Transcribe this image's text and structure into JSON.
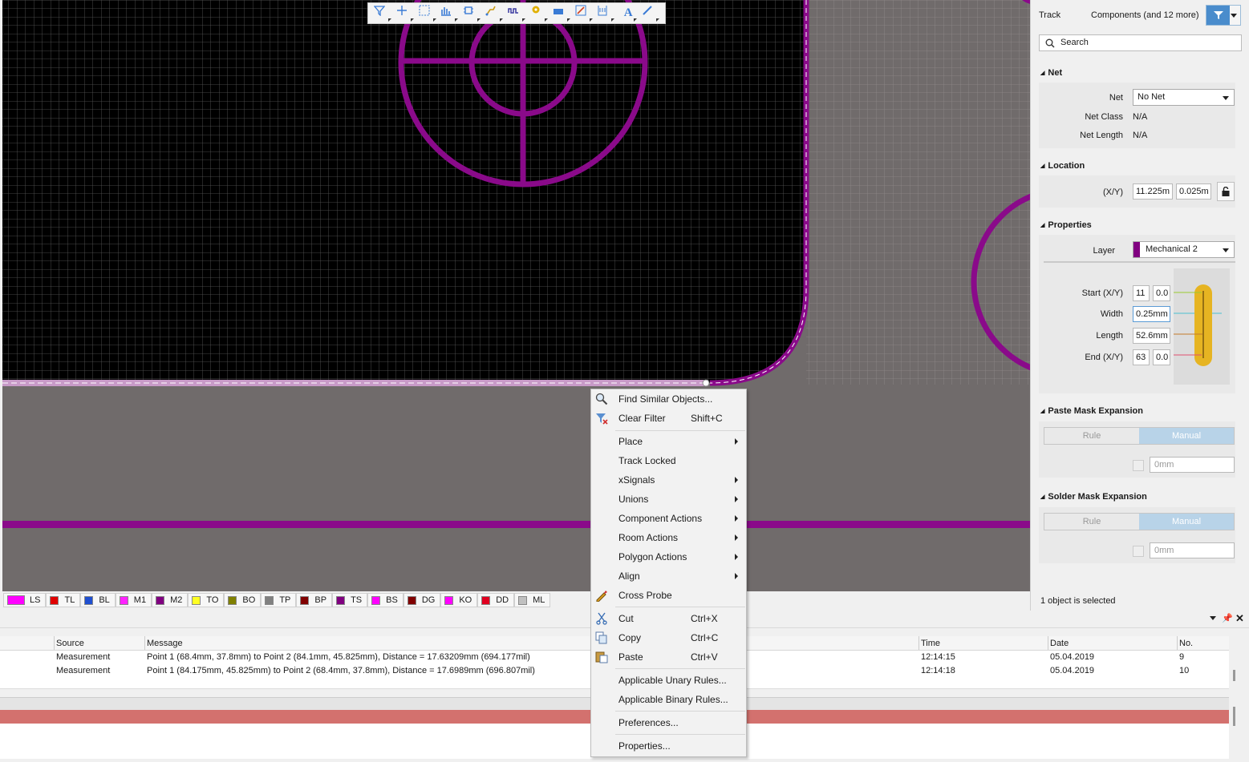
{
  "toolbar": {
    "icons": [
      "filter-icon",
      "move-icon",
      "select-rect-icon",
      "chart-icon",
      "component-icon",
      "route-icon",
      "tune-icon",
      "pad-icon",
      "fill-icon",
      "string-icon",
      "dimension-icon",
      "text-icon",
      "line-icon"
    ]
  },
  "layers": [
    {
      "label": "LS",
      "color": "#ff00ff"
    },
    {
      "label": "TL",
      "color": "#e00000"
    },
    {
      "label": "BL",
      "color": "#1f4fd0"
    },
    {
      "label": "M1",
      "color": "#ff22ff"
    },
    {
      "label": "M2",
      "color": "#800080"
    },
    {
      "label": "TO",
      "color": "#ffff22"
    },
    {
      "label": "BO",
      "color": "#808000"
    },
    {
      "label": "TP",
      "color": "#808080"
    },
    {
      "label": "BP",
      "color": "#800000"
    },
    {
      "label": "TS",
      "color": "#800080"
    },
    {
      "label": "BS",
      "color": "#ff00ff"
    },
    {
      "label": "DG",
      "color": "#800000"
    },
    {
      "label": "KO",
      "color": "#ff00ff"
    },
    {
      "label": "DD",
      "color": "#e00020"
    },
    {
      "label": "ML",
      "color": "#c0c0c0"
    }
  ],
  "panel": {
    "object_type": "Track",
    "filter_text": "Components (and 12 more)",
    "search_placeholder": "Search",
    "net": {
      "title": "Net",
      "net_label": "Net",
      "net_value": "No Net",
      "class_label": "Net Class",
      "class_value": "N/A",
      "length_label": "Net Length",
      "length_value": "N/A"
    },
    "location": {
      "title": "Location",
      "xy_label": "(X/Y)",
      "x": "11.225m",
      "y": "0.025m"
    },
    "properties": {
      "title": "Properties",
      "layer_label": "Layer",
      "layer_value": "Mechanical 2",
      "start_label": "Start (X/Y)",
      "start_x": "11",
      "start_y": "0.0",
      "width_label": "Width",
      "width_value": "0.25mm",
      "length_label": "Length",
      "length_value": "52.6mm",
      "end_label": "End (X/Y)",
      "end_x": "63",
      "end_y": "0.0"
    },
    "paste": {
      "title": "Paste Mask Expansion",
      "rule": "Rule",
      "manual": "Manual",
      "value": "0mm"
    },
    "solder": {
      "title": "Solder Mask Expansion",
      "rule": "Rule",
      "manual": "Manual",
      "value": "0mm"
    },
    "status": "1 object is selected"
  },
  "messages": {
    "headers": {
      "source": "Source",
      "message": "Message",
      "time": "Time",
      "date": "Date",
      "no": "No."
    },
    "rows": [
      {
        "source": "Measurement",
        "message": "Point 1 (68.4mm, 37.8mm) to Point 2 (84.1mm, 45.825mm), Distance = 17.63209mm (694.177mil)",
        "time": "12:14:15",
        "date": "05.04.2019",
        "no": "9"
      },
      {
        "source": "Measurement",
        "message": "Point 1 (84.175mm, 45.825mm) to Point 2 (68.4mm, 37.8mm), Distance = 17.6989mm (696.807mil)",
        "time": "12:14:18",
        "date": "05.04.2019",
        "no": "10"
      }
    ]
  },
  "context_menu": {
    "find_similar": "Find Similar Objects...",
    "clear_filter": "Clear Filter",
    "clear_filter_key": "Shift+C",
    "place": "Place",
    "track_locked": "Track Locked",
    "xsignals": "xSignals",
    "unions": "Unions",
    "component_actions": "Component Actions",
    "room_actions": "Room Actions",
    "polygon_actions": "Polygon Actions",
    "align": "Align",
    "cross_probe": "Cross Probe",
    "cut": "Cut",
    "cut_key": "Ctrl+X",
    "copy": "Copy",
    "copy_key": "Ctrl+C",
    "paste": "Paste",
    "paste_key": "Ctrl+V",
    "unary_rules": "Applicable Unary Rules...",
    "binary_rules": "Applicable Binary Rules...",
    "preferences": "Preferences...",
    "properties": "Properties..."
  }
}
